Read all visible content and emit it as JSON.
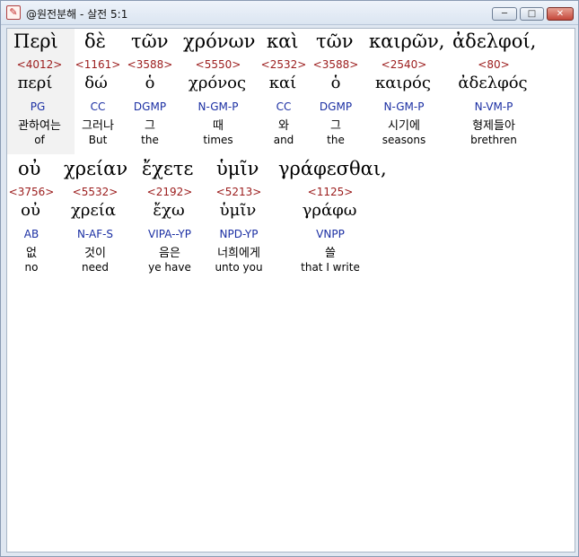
{
  "window": {
    "title": "@원전분해 - 살전 5:1",
    "minimize_label": "─",
    "maximize_label": "□",
    "close_label": "✕",
    "app_icon": "app-logo-icon"
  },
  "rows": [
    {
      "words": [
        {
          "greek": "Περὶ",
          "strong": "<4012>",
          "lemma": "περί",
          "parse": "PG",
          "korean": "관하여는",
          "english": "of"
        },
        {
          "greek": "δὲ",
          "strong": "<1161>",
          "lemma": "δώ",
          "parse": "CC",
          "korean": "그러나",
          "english": "But"
        },
        {
          "greek": "τῶν",
          "strong": "<3588>",
          "lemma": "ὁ",
          "parse": "DGMP",
          "korean": "그",
          "english": "the"
        },
        {
          "greek": "χρόνων",
          "strong": "<5550>",
          "lemma": "χρόνος",
          "parse": "N-GM-P",
          "korean": "때",
          "english": "times"
        },
        {
          "greek": "καὶ",
          "strong": "<2532>",
          "lemma": "καί",
          "parse": "CC",
          "korean": "와",
          "english": "and"
        },
        {
          "greek": "τῶν",
          "strong": "<3588>",
          "lemma": "ὁ",
          "parse": "DGMP",
          "korean": "그",
          "english": "the"
        },
        {
          "greek": "καιρῶν,",
          "strong": "<2540>",
          "lemma": "καιρός",
          "parse": "N-GM-P",
          "korean": "시기에",
          "english": "seasons"
        },
        {
          "greek": "ἀδελφοί,",
          "strong": "<80>",
          "lemma": "ἀδελφός",
          "parse": "N-VM-P",
          "korean": "형제들아",
          "english": "brethren"
        }
      ]
    },
    {
      "words": [
        {
          "greek": "οὐ",
          "strong": "<3756>",
          "lemma": "οὐ",
          "parse": "AB",
          "korean": "없",
          "english": "no"
        },
        {
          "greek": "χρείαν",
          "strong": "<5532>",
          "lemma": "χρεία",
          "parse": "N-AF-S",
          "korean": "것이",
          "english": "need"
        },
        {
          "greek": "ἔχετε",
          "strong": "<2192>",
          "lemma": "ἔχω",
          "parse": "VIPA--YP",
          "korean": "음은",
          "english": "ye have"
        },
        {
          "greek": "ὑμῖν",
          "strong": "<5213>",
          "lemma": "ὑμῖν",
          "parse": "NPD-YP",
          "korean": "너희에게",
          "english": "unto you"
        },
        {
          "greek": "γράφεσθαι,",
          "strong": "<1125>",
          "lemma": "γράφω",
          "parse": "VNPP",
          "korean": "쓸",
          "english": "that I write"
        }
      ]
    }
  ]
}
